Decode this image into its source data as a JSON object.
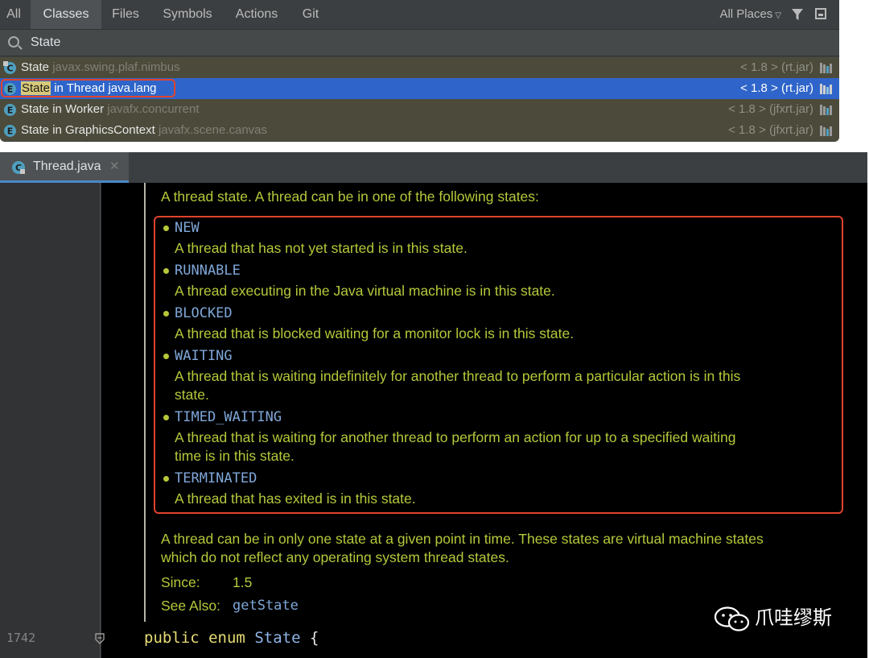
{
  "search_popup": {
    "tabs": [
      "All",
      "Classes",
      "Files",
      "Symbols",
      "Actions",
      "Git"
    ],
    "active_tab": "Classes",
    "places": "All Places",
    "query": "State",
    "results": [
      {
        "highlight": "State",
        "rest": "",
        "package": "javax.swing.plaf.nimbus",
        "version": "< 1.8 > (rt.jar)",
        "selected": false
      },
      {
        "highlight": "State",
        "rest": " in Thread",
        "package": "java.lang",
        "version": "< 1.8 > (rt.jar)",
        "selected": true
      },
      {
        "highlight": "State",
        "rest": " in Worker",
        "package": "javafx.concurrent",
        "version": "< 1.8 > (jfxrt.jar)",
        "selected": false
      },
      {
        "highlight": "State",
        "rest": " in GraphicsContext",
        "package": "javafx.scene.canvas",
        "version": "< 1.8 > (jfxrt.jar)",
        "selected": false
      }
    ]
  },
  "editor": {
    "tab_label": "Thread.java",
    "doc_intro": "A thread state. A thread can be in one of the following states:",
    "states": [
      {
        "name": "NEW",
        "desc": [
          "A thread that has not yet started is in this state."
        ]
      },
      {
        "name": "RUNNABLE",
        "desc": [
          "A thread executing in the Java virtual machine is in this state."
        ]
      },
      {
        "name": "BLOCKED",
        "desc": [
          "A thread that is blocked waiting for a monitor lock is in this state."
        ]
      },
      {
        "name": "WAITING",
        "desc": [
          "A thread that is waiting indefinitely for another thread to perform a particular action is in this",
          "state."
        ]
      },
      {
        "name": "TIMED_WAITING",
        "desc": [
          "A thread that is waiting for another thread to perform an action for up to a specified waiting",
          "time is in this state."
        ]
      },
      {
        "name": "TERMINATED",
        "desc": [
          "A thread that has exited is in this state."
        ]
      }
    ],
    "doc_after": [
      "A thread can be in only one state at a given point in time. These states are virtual machine states",
      "which do not reflect any operating system thread states."
    ],
    "since_label": "Since:",
    "since_value": "1.5",
    "see_also_label": "See Also:",
    "see_also_link": "getState",
    "line_number": "1742",
    "code_keyword_1": "public",
    "code_keyword_2": "enum",
    "code_identifier": "State",
    "code_brace": "{"
  },
  "watermark": {
    "text": "爪哇缪斯"
  },
  "colors": {
    "selection": "#2f65ca",
    "highlight_box": "#e0432d",
    "doc_text": "#b6c83a",
    "link": "#7fa7d9"
  }
}
